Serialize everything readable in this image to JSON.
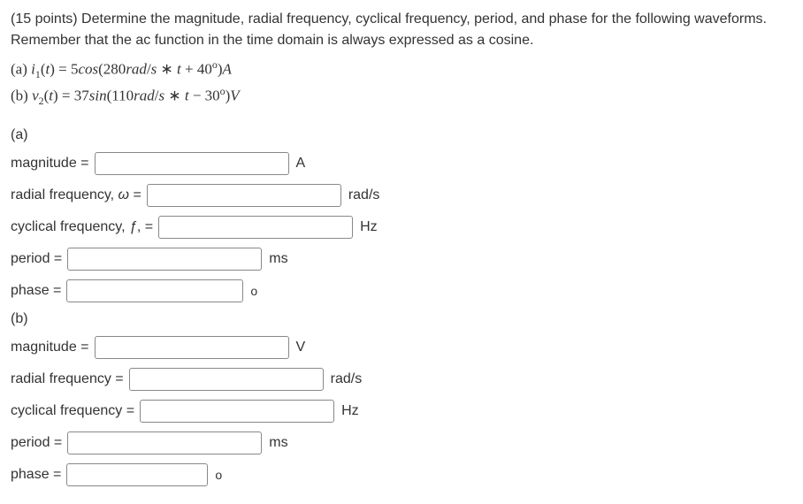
{
  "problem": {
    "intro": "(15 points) Determine the magnitude, radial frequency, cyclical frequency, period, and phase for the following waveforms. Remember that the ac function in the time domain is always expressed as a cosine.",
    "eq_a_prefix": "(a) ",
    "eq_a_html": "i₁(t) = 5cos(280rad/s * t + 40∘)A",
    "eq_b_prefix": "(b) ",
    "eq_b_html": "v₂(t) = 37sin(110rad/s * t − 30∘)V"
  },
  "a": {
    "section_label": "(a)",
    "magnitude_label": "magnitude =",
    "magnitude_unit": "A",
    "radfreq_label_pre": "radial frequency, ",
    "radfreq_symbol": "ω",
    "radfreq_label_post": " =",
    "radfreq_unit": "rad/s",
    "cycfreq_label_pre": "cyclical frequency, ",
    "cycfreq_symbol": "ƒ",
    "cycfreq_label_post": ", =",
    "cycfreq_unit": "Hz",
    "period_label": "period =",
    "period_unit": "ms",
    "phase_label": "phase =",
    "phase_unit": "o"
  },
  "b": {
    "section_label": "(b)",
    "magnitude_label": "magnitude =",
    "magnitude_unit": "V",
    "radfreq_label": "radial frequency =",
    "radfreq_unit": "rad/s",
    "cycfreq_label": "cyclical frequency =",
    "cycfreq_unit": "Hz",
    "period_label": "period =",
    "period_unit": "ms",
    "phase_label": "phase =",
    "phase_unit": "o"
  }
}
